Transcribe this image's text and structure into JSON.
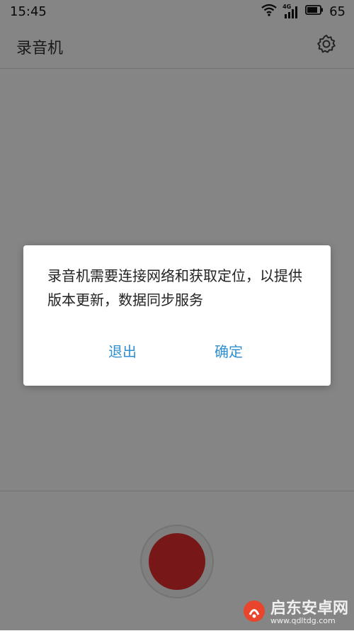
{
  "status_bar": {
    "time": "15:45",
    "network_label": "4G",
    "battery_level": "65"
  },
  "app_bar": {
    "title": "录音机"
  },
  "dialog": {
    "message": "录音机需要连接网络和获取定位，以提供版本更新，数据同步服务",
    "exit_label": "退出",
    "ok_label": "确定"
  },
  "watermark": {
    "name": "启东安卓网",
    "url": "www.qdltdg.com"
  },
  "colors": {
    "accent": "#2f8fd0",
    "record": "#e62d2d"
  }
}
